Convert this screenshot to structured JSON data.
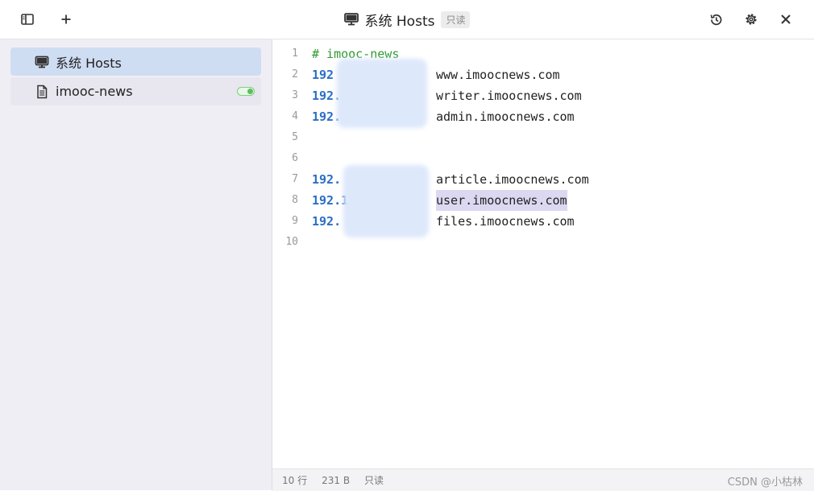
{
  "window": {
    "title": "系统 Hosts",
    "readonly_badge": "只读"
  },
  "toolbar": {
    "left_icons": [
      "sidebar-toggle-icon",
      "plus-icon"
    ],
    "right_icons": [
      "history-icon",
      "gear-icon",
      "close-icon"
    ]
  },
  "sidebar": {
    "items": [
      {
        "label": "系统 Hosts",
        "icon": "monitor-icon",
        "active": true
      },
      {
        "label": "imooc-news",
        "icon": "document-icon",
        "enabled": true
      }
    ]
  },
  "editor": {
    "lines": [
      {
        "num": "1",
        "ip": "",
        "host": "",
        "comment": "# imooc-news"
      },
      {
        "num": "2",
        "ip": "192",
        "host": "www.imoocnews.com",
        "comment": ""
      },
      {
        "num": "3",
        "ip": "192.1",
        "host": "writer.imoocnews.com",
        "comment": ""
      },
      {
        "num": "4",
        "ip": "192.1",
        "host": "admin.imoocnews.com",
        "comment": ""
      },
      {
        "num": "5",
        "ip": "",
        "host": "",
        "comment": ""
      },
      {
        "num": "6",
        "ip": "",
        "host": "",
        "comment": ""
      },
      {
        "num": "7",
        "ip": "192.",
        "host": "article.imoocnews.com",
        "comment": ""
      },
      {
        "num": "8",
        "ip": "192.1",
        "host": "user.imoocnews.com",
        "comment": ""
      },
      {
        "num": "9",
        "ip": "192.",
        "host": "files.imoocnews.com",
        "comment": ""
      },
      {
        "num": "10",
        "ip": "",
        "host": "",
        "comment": ""
      }
    ]
  },
  "statusbar": {
    "lines": "10 行",
    "size": "231 B",
    "mode": "只读",
    "watermark": "CSDN @小枯林"
  },
  "colors": {
    "accent": "#cfddf3",
    "comment": "#2e9a2e",
    "ip": "#2a6fc4",
    "toggle_on": "#5cbf5c"
  }
}
